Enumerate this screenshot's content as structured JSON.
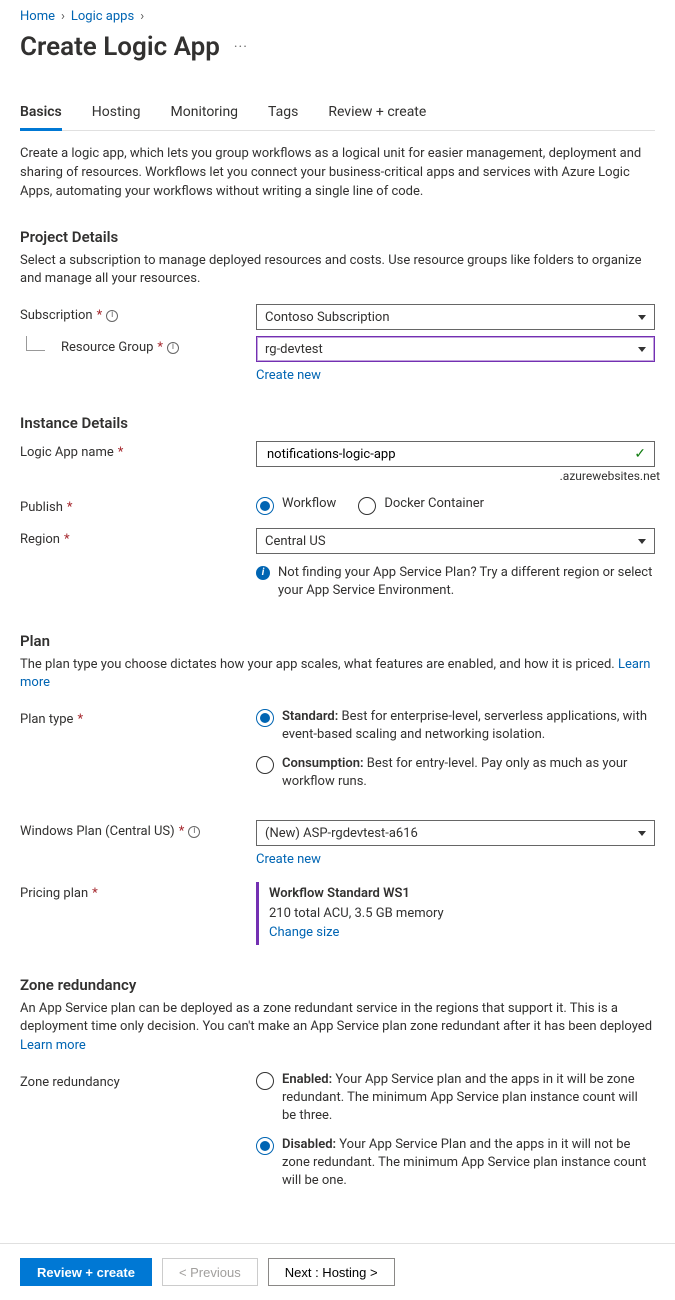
{
  "breadcrumb": {
    "home": "Home",
    "logic_apps": "Logic apps"
  },
  "title": "Create Logic App",
  "tabs": {
    "basics": "Basics",
    "hosting": "Hosting",
    "monitoring": "Monitoring",
    "tags": "Tags",
    "review": "Review + create"
  },
  "intro": "Create a logic app, which lets you group workflows as a logical unit for easier management, deployment and sharing of resources. Workflows let you connect your business-critical apps and services with Azure Logic Apps, automating your workflows without writing a single line of code.",
  "project": {
    "heading": "Project Details",
    "desc": "Select a subscription to manage deployed resources and costs. Use resource groups like folders to organize and manage all your resources.",
    "subscription_label": "Subscription",
    "subscription_value": "Contoso Subscription",
    "rg_label": "Resource Group",
    "rg_value": "rg-devtest",
    "create_new": "Create new"
  },
  "instance": {
    "heading": "Instance Details",
    "name_label": "Logic App name",
    "name_value": "notifications-logic-app",
    "suffix": ".azurewebsites.net",
    "publish_label": "Publish",
    "publish_workflow": "Workflow",
    "publish_docker": "Docker Container",
    "region_label": "Region",
    "region_value": "Central US",
    "region_tip": "Not finding your App Service Plan? Try a different region or select your App Service Environment."
  },
  "plan": {
    "heading": "Plan",
    "desc": "The plan type you choose dictates how your app scales, what features are enabled, and how it is priced.",
    "learn_more": "Learn more",
    "type_label": "Plan type",
    "standard_bold": "Standard:",
    "standard_text": " Best for enterprise-level, serverless applications, with event-based scaling and networking isolation.",
    "consumption_bold": "Consumption:",
    "consumption_text": " Best for entry-level. Pay only as much as your workflow runs.",
    "winplan_label": "Windows Plan (Central US)",
    "winplan_value": "(New) ASP-rgdevtest-a616",
    "create_new": "Create new",
    "pricing_label": "Pricing plan",
    "pricing_name": "Workflow Standard WS1",
    "pricing_detail": "210 total ACU, 3.5 GB memory",
    "change_size": "Change size"
  },
  "zone": {
    "heading": "Zone redundancy",
    "desc": "An App Service plan can be deployed as a zone redundant service in the regions that support it. This is a deployment time only decision. You can't make an App Service plan zone redundant after it has been deployed",
    "learn_more": "Learn more",
    "label": "Zone redundancy",
    "enabled_bold": "Enabled:",
    "enabled_text": " Your App Service plan and the apps in it will be zone redundant. The minimum App Service plan instance count will be three.",
    "disabled_bold": "Disabled:",
    "disabled_text": " Your App Service Plan and the apps in it will not be zone redundant. The minimum App Service plan instance count will be one."
  },
  "footer": {
    "review": "Review + create",
    "prev": "< Previous",
    "next": "Next : Hosting >"
  }
}
